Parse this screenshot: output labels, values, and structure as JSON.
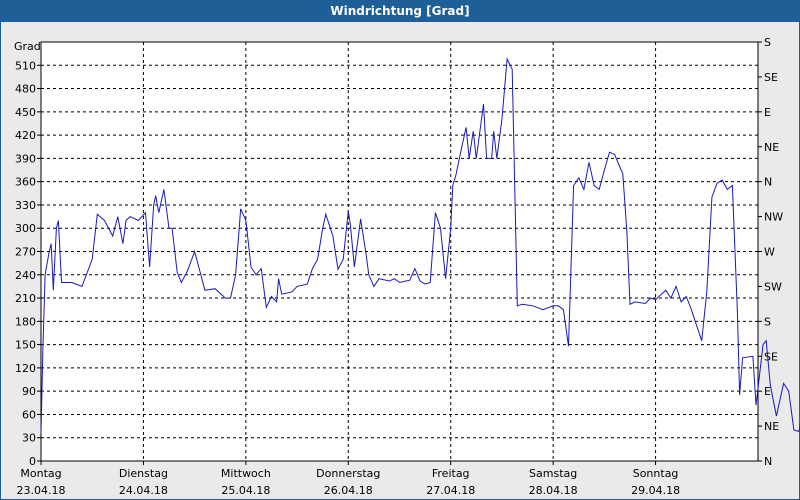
{
  "window": {
    "title": "Windrichtung [Grad]"
  },
  "chart_data": {
    "type": "line",
    "title": "Windrichtung [Grad]",
    "ylabel": "Grad",
    "ylim": [
      0,
      540
    ],
    "y_ticks": [
      0,
      30,
      60,
      90,
      120,
      150,
      180,
      210,
      240,
      270,
      300,
      330,
      360,
      390,
      420,
      450,
      480,
      510
    ],
    "right_axis_labels": [
      "S",
      "SE",
      "E",
      "NE",
      "N",
      "NW",
      "W",
      "SW",
      "S",
      "SE",
      "E",
      "NE",
      "N"
    ],
    "x_labels": [
      {
        "day": "Montag",
        "date": "23.04.18"
      },
      {
        "day": "Dienstag",
        "date": "24.04.18"
      },
      {
        "day": "Mittwoch",
        "date": "25.04.18"
      },
      {
        "day": "Donnerstag",
        "date": "26.04.18"
      },
      {
        "day": "Freitag",
        "date": "27.04.18"
      },
      {
        "day": "Samstag",
        "date": "28.04.18"
      },
      {
        "day": "Sonntag",
        "date": "29.04.18"
      }
    ],
    "grid": true,
    "series": [
      {
        "color": "#1a1ab8",
        "values": [
          [
            0,
            35
          ],
          [
            0.02,
            150
          ],
          [
            0.04,
            240
          ],
          [
            0.08,
            270
          ],
          [
            0.1,
            280
          ],
          [
            0.12,
            220
          ],
          [
            0.15,
            300
          ],
          [
            0.17,
            310
          ],
          [
            0.2,
            230
          ],
          [
            0.3,
            230
          ],
          [
            0.4,
            225
          ],
          [
            0.5,
            260
          ],
          [
            0.55,
            318
          ],
          [
            0.62,
            310
          ],
          [
            0.7,
            290
          ],
          [
            0.75,
            315
          ],
          [
            0.8,
            280
          ],
          [
            0.83,
            310
          ],
          [
            0.87,
            315
          ],
          [
            0.95,
            310
          ],
          [
            1.02,
            320
          ],
          [
            1.06,
            250
          ],
          [
            1.1,
            330
          ],
          [
            1.12,
            342
          ],
          [
            1.15,
            320
          ],
          [
            1.2,
            350
          ],
          [
            1.25,
            300
          ],
          [
            1.28,
            300
          ],
          [
            1.33,
            243
          ],
          [
            1.37,
            230
          ],
          [
            1.43,
            245
          ],
          [
            1.5,
            270
          ],
          [
            1.55,
            245
          ],
          [
            1.6,
            220
          ],
          [
            1.7,
            222
          ],
          [
            1.8,
            210
          ],
          [
            1.85,
            210
          ],
          [
            1.9,
            240
          ],
          [
            1.95,
            325
          ],
          [
            2.0,
            310
          ],
          [
            2.05,
            250
          ],
          [
            2.1,
            240
          ],
          [
            2.15,
            248
          ],
          [
            2.2,
            198
          ],
          [
            2.25,
            212
          ],
          [
            2.3,
            205
          ],
          [
            2.32,
            235
          ],
          [
            2.35,
            215
          ],
          [
            2.45,
            218
          ],
          [
            2.5,
            225
          ],
          [
            2.6,
            228
          ],
          [
            2.65,
            248
          ],
          [
            2.7,
            260
          ],
          [
            2.75,
            300
          ],
          [
            2.78,
            318
          ],
          [
            2.85,
            290
          ],
          [
            2.9,
            247
          ],
          [
            2.95,
            260
          ],
          [
            3.0,
            322
          ],
          [
            3.02,
            305
          ],
          [
            3.06,
            250
          ],
          [
            3.12,
            312
          ],
          [
            3.17,
            270
          ],
          [
            3.2,
            240
          ],
          [
            3.25,
            225
          ],
          [
            3.3,
            235
          ],
          [
            3.4,
            232
          ],
          [
            3.45,
            235
          ],
          [
            3.5,
            230
          ],
          [
            3.6,
            233
          ],
          [
            3.65,
            248
          ],
          [
            3.7,
            232
          ],
          [
            3.75,
            228
          ],
          [
            3.8,
            230
          ],
          [
            3.85,
            320
          ],
          [
            3.9,
            300
          ],
          [
            3.95,
            235
          ],
          [
            4.0,
            300
          ],
          [
            4.02,
            355
          ],
          [
            4.05,
            368
          ],
          [
            4.1,
            400
          ],
          [
            4.15,
            430
          ],
          [
            4.18,
            390
          ],
          [
            4.22,
            425
          ],
          [
            4.25,
            390
          ],
          [
            4.28,
            420
          ],
          [
            4.32,
            460
          ],
          [
            4.35,
            390
          ],
          [
            4.4,
            390
          ],
          [
            4.42,
            425
          ],
          [
            4.45,
            390
          ],
          [
            4.5,
            440
          ],
          [
            4.55,
            518
          ],
          [
            4.6,
            505
          ],
          [
            4.65,
            200
          ],
          [
            4.7,
            202
          ],
          [
            4.8,
            200
          ],
          [
            4.9,
            195
          ],
          [
            5.0,
            200
          ],
          [
            5.05,
            200
          ],
          [
            5.1,
            195
          ],
          [
            5.15,
            148
          ],
          [
            5.2,
            355
          ],
          [
            5.25,
            365
          ],
          [
            5.3,
            350
          ],
          [
            5.35,
            385
          ],
          [
            5.4,
            355
          ],
          [
            5.45,
            350
          ],
          [
            5.5,
            375
          ],
          [
            5.55,
            398
          ],
          [
            5.6,
            395
          ],
          [
            5.68,
            370
          ],
          [
            5.72,
            295
          ],
          [
            5.75,
            202
          ],
          [
            5.8,
            205
          ],
          [
            5.9,
            203
          ],
          [
            5.95,
            210
          ],
          [
            6.0,
            208
          ],
          [
            6.1,
            220
          ],
          [
            6.15,
            210
          ],
          [
            6.2,
            225
          ],
          [
            6.25,
            205
          ],
          [
            6.3,
            212
          ],
          [
            6.35,
            195
          ],
          [
            6.4,
            175
          ],
          [
            6.45,
            155
          ],
          [
            6.5,
            218
          ],
          [
            6.55,
            340
          ],
          [
            6.6,
            358
          ],
          [
            6.65,
            362
          ],
          [
            6.7,
            350
          ],
          [
            6.75,
            355
          ],
          [
            6.8,
            188
          ],
          [
            6.82,
            85
          ],
          [
            6.85,
            133
          ],
          [
            6.95,
            135
          ],
          [
            6.98,
            72
          ],
          [
            7.05,
            150
          ],
          [
            7.08,
            155
          ],
          [
            7.12,
            98
          ],
          [
            7.18,
            58
          ],
          [
            7.25,
            100
          ],
          [
            7.3,
            90
          ],
          [
            7.35,
            40
          ],
          [
            7.4,
            38
          ],
          [
            7.43,
            62
          ],
          [
            7.48,
            60
          ],
          [
            7.55,
            82
          ]
        ]
      }
    ]
  }
}
